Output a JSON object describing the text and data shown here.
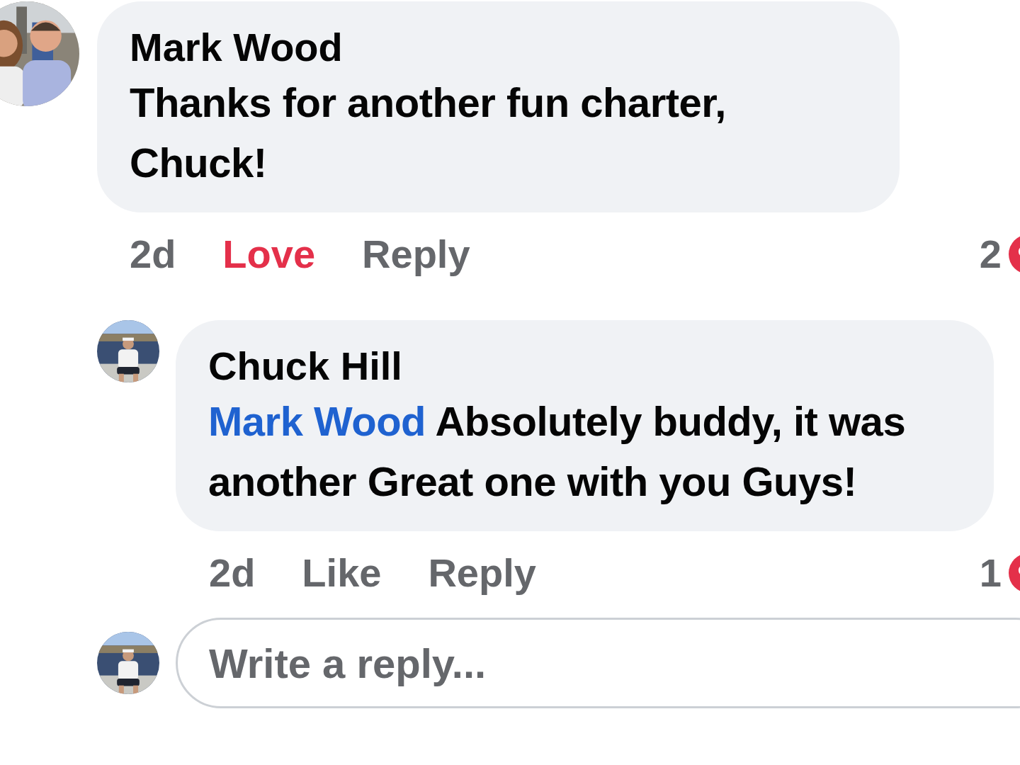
{
  "comments": [
    {
      "author": "Mark Wood",
      "text": "Thanks for another fun charter, Chuck!",
      "time": "2d",
      "reaction_button": {
        "label": "Love",
        "selected": true
      },
      "reply_label": "Reply",
      "reaction_count": "2"
    },
    {
      "author": "Chuck Hill",
      "mention": "Mark Wood",
      "text": "Absolutely buddy, it was another Great one with you Guys!",
      "time": "2d",
      "reaction_button": {
        "label": "Like",
        "selected": false
      },
      "reply_label": "Reply",
      "reaction_count": "1"
    }
  ],
  "reply_box": {
    "placeholder": "Write a reply..."
  }
}
